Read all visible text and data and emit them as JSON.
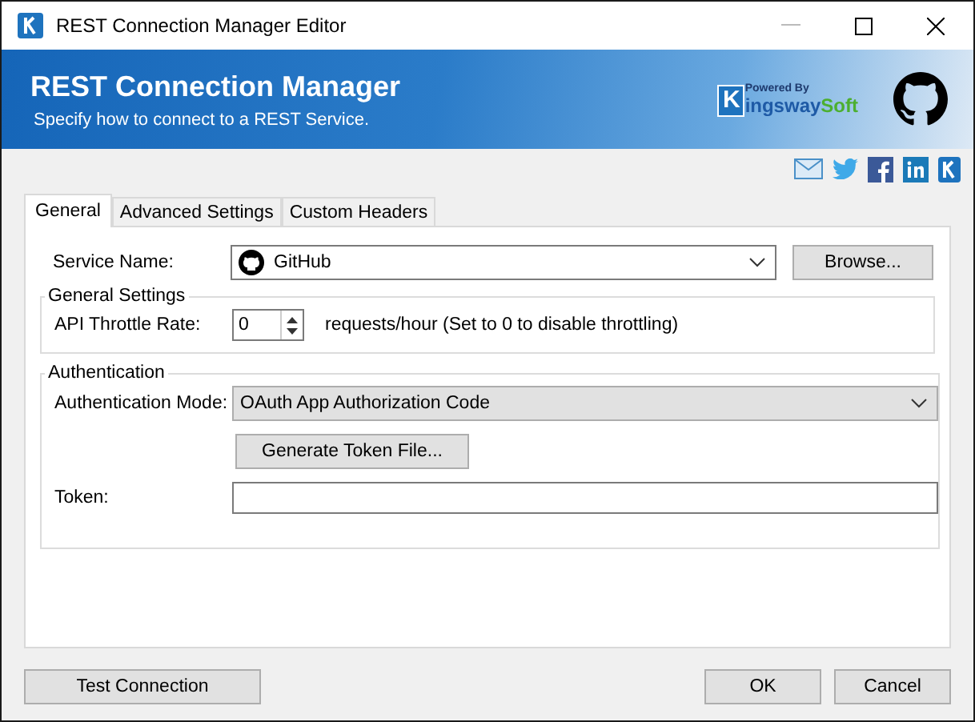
{
  "window": {
    "title": "REST Connection Manager Editor",
    "minimize_disabled": true
  },
  "banner": {
    "title": "REST Connection Manager",
    "subtitle": "Specify how to connect to a REST Service.",
    "logo": {
      "powered_by": "Powered By",
      "letter": "K",
      "name_a": "ingsway",
      "name_b": "Soft"
    }
  },
  "tabs": [
    {
      "label": "General",
      "selected": true
    },
    {
      "label": "Advanced Settings",
      "selected": false
    },
    {
      "label": "Custom Headers",
      "selected": false
    }
  ],
  "service": {
    "label": "Service Name:",
    "value": "GitHub",
    "browse": "Browse..."
  },
  "general_settings": {
    "title": "General Settings",
    "throttle_label": "API Throttle Rate:",
    "throttle_value": "0",
    "throttle_hint": "requests/hour (Set to 0 to disable throttling)"
  },
  "authentication": {
    "title": "Authentication",
    "mode_label": "Authentication Mode:",
    "mode_value": "OAuth App Authorization Code",
    "generate": "Generate Token File...",
    "token_label": "Token:"
  },
  "buttons": {
    "test": "Test Connection",
    "ok": "OK",
    "cancel": "Cancel"
  }
}
